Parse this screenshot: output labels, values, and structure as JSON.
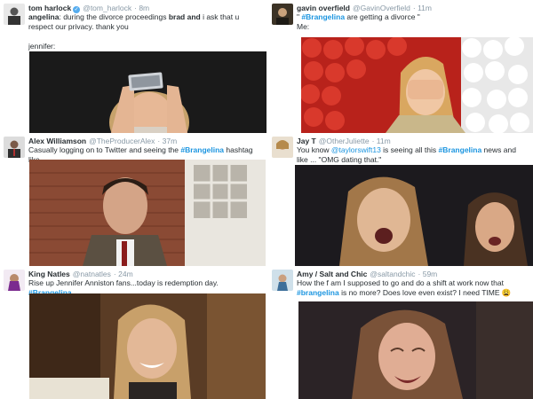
{
  "tweets": [
    {
      "name": "tom harlock",
      "handle": "@tom_harlock",
      "time": "8m",
      "text_segments": [
        "angelina",
        ": during the divorce proceedings ",
        "brad and",
        " i ask that u respect our privacy. thank you"
      ],
      "text2": "jennifer:"
    },
    {
      "name": "gavin overfield",
      "handle": "@GavinOverfield",
      "time": "11m",
      "line1_pre": "\" ",
      "hashtag": "#Brangelina",
      "line1_post": " are getting a divorce \"",
      "line2": "Me:"
    },
    {
      "name": "Alex Williamson",
      "handle": "@TheProducerAlex",
      "time": "37m",
      "pre": "Casually logging on to Twitter and seeing the ",
      "hashtag": "#Brangelina",
      "post": " hashtag like..."
    },
    {
      "name": "Jay T",
      "handle": "@OtherJuliette",
      "time": "11m",
      "pre": "You know ",
      "mention": "@taylorswift13",
      "mid": " is seeing all this ",
      "hashtag": "#Brangelina",
      "post": " news and like ... \"OMG dating that.\""
    },
    {
      "name": "King Natles",
      "handle": "@natnatles",
      "time": "24m",
      "pre": "Rise up Jennifer Anniston fans...today is redemption day. ",
      "hashtag": "#Brangelina"
    },
    {
      "name": "Amy / Salt and Chic",
      "handle": "@saltandchic",
      "time": "59m",
      "pre": "How the f am I supposed to go and do a shift at work now that ",
      "hashtag": "#brangelina",
      "post": " is no more? Does love even exist? I need TIME ",
      "emoji": "😩"
    }
  ],
  "icons": [
    "verified-badge-icon"
  ],
  "colors": {
    "link": "#1b95e0",
    "muted": "#8899a6",
    "text": "#292f33"
  }
}
